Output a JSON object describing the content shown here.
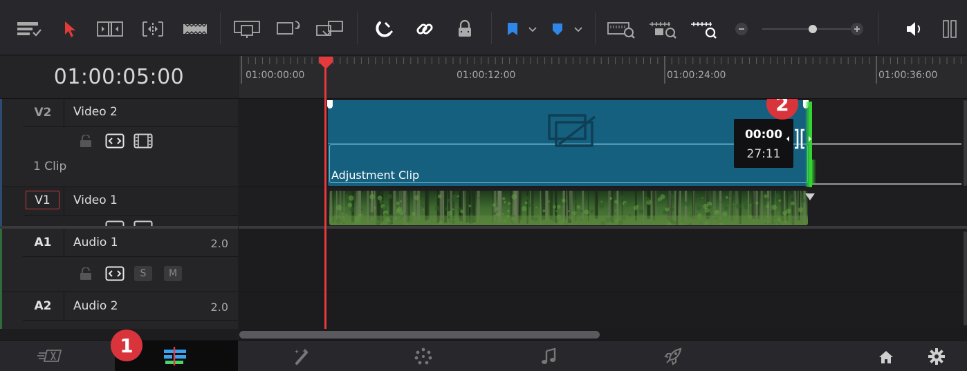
{
  "timecode": "01:00:05:00",
  "ruler": {
    "labels": [
      "01:00:00:00",
      "01:00:12:00",
      "01:00:24:00",
      "01:00:36:00"
    ]
  },
  "tracks": {
    "v2": {
      "id": "V2",
      "name": "Video 2",
      "clip_count": "1 Clip"
    },
    "v1": {
      "id": "V1",
      "name": "Video 1"
    },
    "a1": {
      "id": "A1",
      "name": "Audio 1",
      "channels": "2.0",
      "solo": "S",
      "mute": "M"
    },
    "a2": {
      "id": "A2",
      "name": "Audio 2",
      "channels": "2.0"
    }
  },
  "clips": {
    "adjustment": {
      "label": "Adjustment Clip"
    }
  },
  "trim_tooltip": {
    "line1": "00:00",
    "line2": "27:11"
  },
  "badges": {
    "one": "1",
    "two": "2"
  },
  "colors": {
    "playhead": "#e5393b",
    "adjustment_clip": "#16607f",
    "trim_green": "#33d42e",
    "accent_blue": "#2d86e8",
    "badge": "#d9343c"
  },
  "icons": {
    "toolbar": [
      "timeline-options-icon",
      "selection-pointer-icon",
      "trim-edit-icon",
      "dynamic-trim-icon",
      "blade-icon",
      "insert-clip-icon",
      "overwrite-clip-icon",
      "replace-clip-icon",
      "snapping-magnet-icon",
      "linked-selection-icon",
      "position-lock-icon",
      "flag-icon",
      "marker-icon",
      "full-extent-zoom-icon",
      "detail-zoom-icon",
      "custom-zoom-icon",
      "zoom-out-icon",
      "zoom-in-icon",
      "volume-icon",
      "audio-meter-icon"
    ],
    "pages": [
      "cut-page-icon",
      "edit-page-icon",
      "fusion-page-icon",
      "color-page-icon",
      "fairlight-page-icon",
      "deliver-page-icon",
      "home-icon",
      "settings-gear-icon"
    ]
  }
}
